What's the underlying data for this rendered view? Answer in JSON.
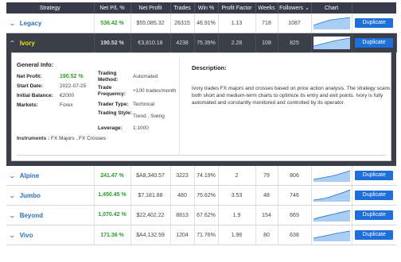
{
  "headers": {
    "strategy": "Strategy",
    "pl": "Net P/L %",
    "profit": "Net Profit",
    "trades": "Trades",
    "win": "Win %",
    "pf": "Profit Factor",
    "weeks": "Weeks",
    "followers": "Followers",
    "chart": "Chart"
  },
  "duplicate_label": "Duplicate",
  "rows": [
    {
      "name": "Legacy",
      "pl": "536.42 %",
      "profit": "$55,085.32",
      "trades": "26315",
      "win": "46.91%",
      "pf": "1.13",
      "weeks": "718",
      "followers": "1087"
    },
    {
      "name": "Ivory",
      "pl": "190.52 %",
      "profit": "€3,810.18",
      "trades": "4238",
      "win": "75.39%",
      "pf": "2.28",
      "weeks": "108",
      "followers": "825"
    },
    {
      "name": "Alpine",
      "pl": "241.47 %",
      "profit": "$A8,340.57",
      "trades": "3223",
      "win": "74.19%",
      "pf": "2",
      "weeks": "79",
      "followers": "806"
    },
    {
      "name": "Jumbo",
      "pl": "1,450.45 %",
      "profit": "$7,181.88",
      "trades": "480",
      "win": "75.62%",
      "pf": "3.53",
      "weeks": "48",
      "followers": "746"
    },
    {
      "name": "Beyond",
      "pl": "1,070.42 %",
      "profit": "$22,402.22",
      "trades": "8813",
      "win": "67.62%",
      "pf": "1.9",
      "weeks": "154",
      "followers": "669"
    },
    {
      "name": "Vivo",
      "pl": "171.36 %",
      "profit": "$A4,132.59",
      "trades": "1204",
      "win": "71.76%",
      "pf": "1.96",
      "weeks": "80",
      "followers": "638"
    }
  ],
  "detail": {
    "general_title": "General Info:",
    "net_profit_label": "Net Profit:",
    "net_profit_value": "190.52 %",
    "start_date_label": "Start Date:",
    "start_date_value": "2022-07-25",
    "initial_balance_label": "Initial Balance:",
    "initial_balance_value": "€2000",
    "markets_label": "Markets:",
    "markets_value": "Forex",
    "trading_method_label": "Trading Method:",
    "trading_method_value": "Automated",
    "trading_frequency_label": "Trade Frequency:",
    "trading_frequency_value": "+100 trades/month",
    "trader_type_label": "Trader Type:",
    "trader_type_value": "Technical",
    "trading_style_label": "Trading Style:",
    "trading_style_value": "Trend , Swing",
    "leverage_label": "Leverage:",
    "leverage_value": "1:1000",
    "description_title": "Description:",
    "description_text": "Ivory trades FX majors and crosses based on price action analysis. The strategy scans both short and medium-term charts to optimize its entry and exit points. Ivory is fully automated and constantly monitored and controlled by its operator.",
    "instruments_label": "Instruments :",
    "instruments_value": "FX Majors , FX Crosses"
  },
  "colors": {
    "header_bg": "#353b48",
    "accent_blue": "#1e6fd9",
    "name_blue": "#2f6fb5",
    "green": "#2a9d2a",
    "expanded_name": "#e6e600"
  }
}
